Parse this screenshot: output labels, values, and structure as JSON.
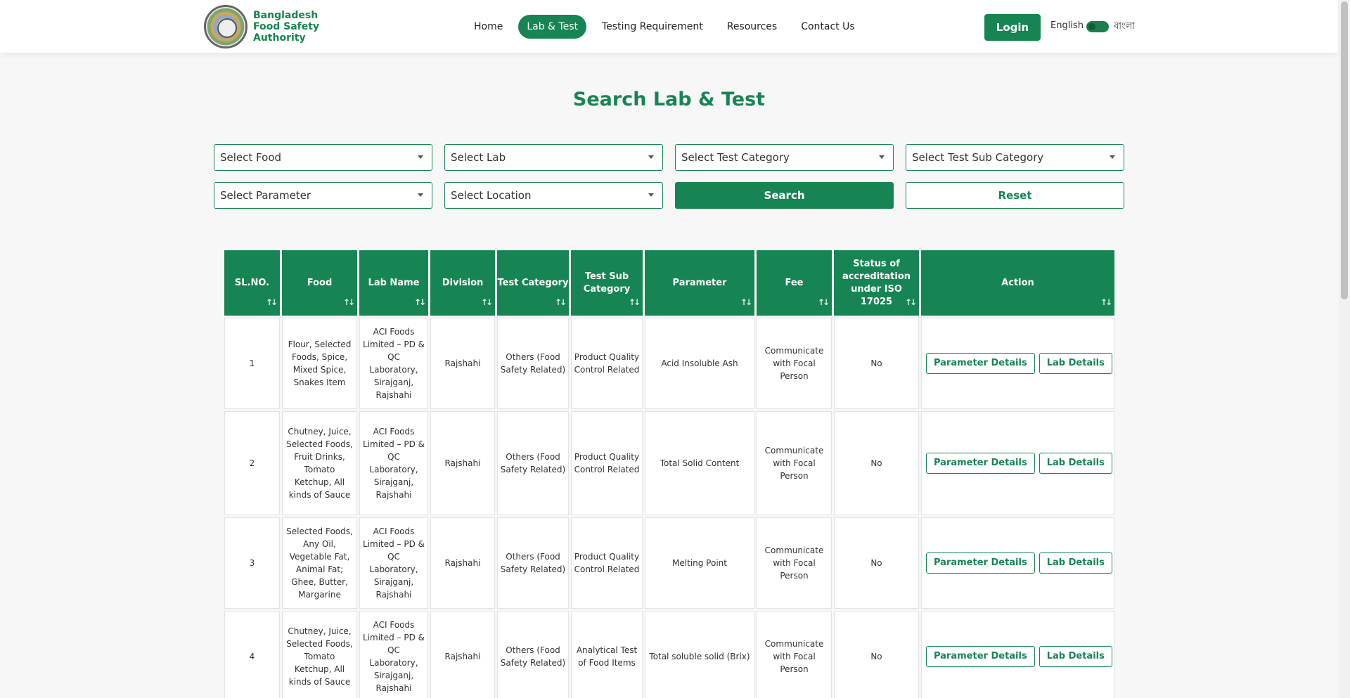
{
  "header": {
    "brand": "Bangladesh Food Safety Authority",
    "nav": [
      "Home",
      "Lab & Test",
      "Testing Requirement",
      "Resources",
      "Contact Us"
    ],
    "active_nav": "Lab & Test",
    "login": "Login",
    "lang_en": "English",
    "lang_bn": "বাংলা"
  },
  "page": {
    "title": "Search Lab & Test"
  },
  "filters": {
    "food": "Select Food",
    "lab": "Select Lab",
    "test_category": "Select Test Category",
    "test_sub_category": "Select Test Sub Category",
    "parameter": "Select Parameter",
    "location": "Select Location",
    "search": "Search",
    "reset": "Reset"
  },
  "table": {
    "headers": [
      "SL.NO.",
      "Food",
      "Lab Name",
      "Division",
      "Test Category",
      "Test Sub Category",
      "Parameter",
      "Fee",
      "Status of accreditation under ISO 17025",
      "Action"
    ],
    "actions": [
      "Parameter Details",
      "Lab Details"
    ],
    "rows": [
      {
        "sl": "1",
        "food": "Flour, Selected Foods, Spice, Mixed Spice, Snakes Item",
        "lab": "ACI Foods Limited – PD & QC Laboratory, Sirajganj, Rajshahi",
        "division": "Rajshahi",
        "category": "Others (Food Safety Related)",
        "subcategory": "Product Quality Control Related",
        "parameter": "Acid Insoluble Ash",
        "fee": "Communicate with Focal Person",
        "status": "No"
      },
      {
        "sl": "2",
        "food": "Chutney, Juice, Selected Foods, Fruit Drinks, Tomato Ketchup, All kinds of Sauce",
        "lab": "ACI Foods Limited – PD & QC Laboratory, Sirajganj, Rajshahi",
        "division": "Rajshahi",
        "category": "Others (Food Safety Related)",
        "subcategory": "Product Quality Control Related",
        "parameter": "Total Solid Content",
        "fee": "Communicate with Focal Person",
        "status": "No"
      },
      {
        "sl": "3",
        "food": "Selected Foods, Any Oil, Vegetable Fat, Animal Fat; Ghee, Butter, Margarine",
        "lab": "ACI Foods Limited – PD & QC Laboratory, Sirajganj, Rajshahi",
        "division": "Rajshahi",
        "category": "Others (Food Safety Related)",
        "subcategory": "Product Quality Control Related",
        "parameter": "Melting Point",
        "fee": "Communicate with Focal Person",
        "status": "No"
      },
      {
        "sl": "4",
        "food": "Chutney, Juice, Selected Foods, Tomato Ketchup, All kinds of Sauce",
        "lab": "ACI Foods Limited – PD & QC Laboratory, Sirajganj, Rajshahi",
        "division": "Rajshahi",
        "category": "Others (Food Safety Related)",
        "subcategory": "Analytical Test of Food Items",
        "parameter": "Total soluble solid (Brix)",
        "fee": "Communicate with Focal Person",
        "status": "No"
      }
    ]
  },
  "icons": {
    "sort": "sort-arrows-icon",
    "dropdown": "chevron-down-icon"
  }
}
